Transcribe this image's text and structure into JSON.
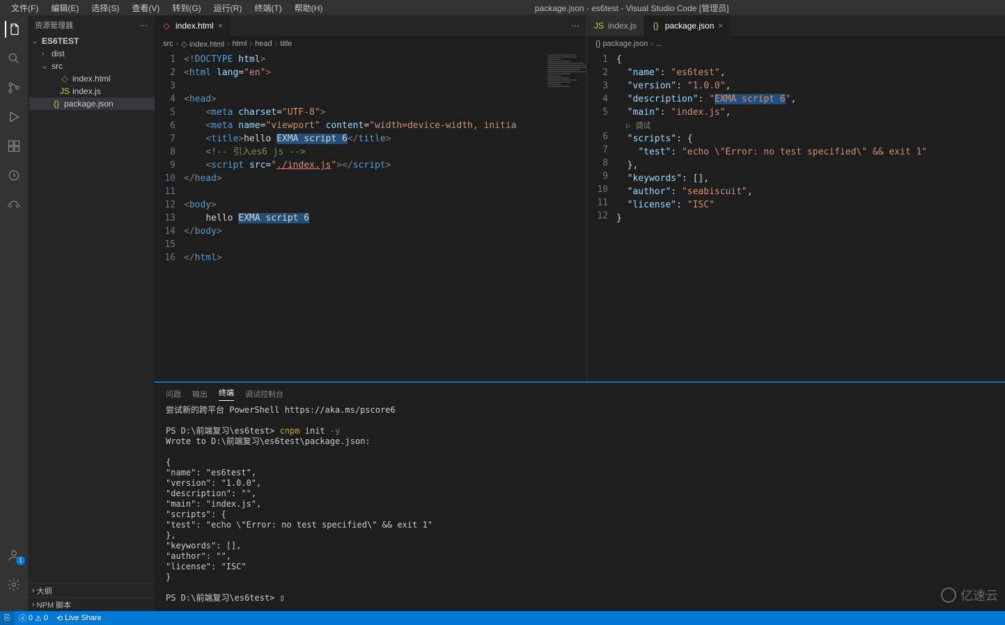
{
  "window": {
    "title": "package.json - es6test - Visual Studio Code [管理员]"
  },
  "menu": [
    "文件(F)",
    "编辑(E)",
    "选择(S)",
    "查看(V)",
    "转到(G)",
    "运行(R)",
    "终端(T)",
    "帮助(H)"
  ],
  "sidebar": {
    "title": "资源管理器",
    "root": "ES6TEST",
    "items": [
      {
        "type": "folder",
        "label": "dist",
        "depth": 1,
        "open": false
      },
      {
        "type": "folder",
        "label": "src",
        "depth": 1,
        "open": true
      },
      {
        "type": "file",
        "label": "index.html",
        "depth": 2,
        "icon": "html"
      },
      {
        "type": "file",
        "label": "index.js",
        "depth": 2,
        "icon": "js"
      },
      {
        "type": "file",
        "label": "package.json",
        "depth": 1,
        "icon": "json",
        "selected": true
      }
    ],
    "footer": [
      "大纲",
      "NPM 脚本"
    ]
  },
  "editors": {
    "left": {
      "tabs": [
        {
          "label": "index.html",
          "icon": "html",
          "active": true
        }
      ],
      "breadcrumbs": [
        "src",
        "index.html",
        "html",
        "head",
        "title"
      ],
      "lines": [
        {
          "n": 1,
          "html": "<span class='tok-bracket'>&lt;!</span><span class='tok-doctype'>DOCTYPE</span> <span class='tok-attr'>html</span><span class='tok-bracket'>&gt;</span>"
        },
        {
          "n": 2,
          "html": "<span class='tok-bracket'>&lt;</span><span class='tok-tag'>html</span> <span class='tok-attr'>lang</span>=<span class='tok-str'>\"en\"</span><span class='tok-bracket'>&gt;</span>"
        },
        {
          "n": 3,
          "html": ""
        },
        {
          "n": 4,
          "html": "<span class='tok-bracket'>&lt;</span><span class='tok-tag'>head</span><span class='tok-bracket'>&gt;</span>"
        },
        {
          "n": 5,
          "html": "    <span class='tok-bracket'>&lt;</span><span class='tok-tag'>meta</span> <span class='tok-attr'>charset</span>=<span class='tok-str'>\"UTF-8\"</span><span class='tok-bracket'>&gt;</span>"
        },
        {
          "n": 6,
          "html": "    <span class='tok-bracket'>&lt;</span><span class='tok-tag'>meta</span> <span class='tok-attr'>name</span>=<span class='tok-str'>\"viewport\"</span> <span class='tok-attr'>content</span>=<span class='tok-str'>\"width=device-width, initia</span>"
        },
        {
          "n": 7,
          "html": "    <span class='tok-bracket'>&lt;</span><span class='tok-tag'>title</span><span class='tok-bracket'>&gt;</span><span class='tok-txt'>hello </span><span class='sel-bg tok-txt'>EXMA script 6</span><span class='tok-bracket'>&lt;/</span><span class='tok-tag'>title</span><span class='tok-bracket'>&gt;</span>"
        },
        {
          "n": 8,
          "html": "    <span class='tok-comment'>&lt;!-- 引入es6 js --&gt;</span>"
        },
        {
          "n": 9,
          "html": "    <span class='tok-bracket'>&lt;</span><span class='tok-tag'>script</span> <span class='tok-attr'>src</span>=<span class='tok-str'>\"<span class='underline'>./index.js</span>\"</span><span class='tok-bracket'>&gt;&lt;/</span><span class='tok-tag'>script</span><span class='tok-bracket'>&gt;</span>"
        },
        {
          "n": 10,
          "html": "<span class='tok-bracket'>&lt;/</span><span class='tok-tag'>head</span><span class='tok-bracket'>&gt;</span>"
        },
        {
          "n": 11,
          "html": ""
        },
        {
          "n": 12,
          "html": "<span class='tok-bracket'>&lt;</span><span class='tok-tag'>body</span><span class='tok-bracket'>&gt;</span>"
        },
        {
          "n": 13,
          "html": "    <span class='tok-txt'>hello </span><span class='sel-bg tok-txt'>EXMA script 6</span>"
        },
        {
          "n": 14,
          "html": "<span class='tok-bracket'>&lt;/</span><span class='tok-tag'>body</span><span class='tok-bracket'>&gt;</span>"
        },
        {
          "n": 15,
          "html": ""
        },
        {
          "n": 16,
          "html": "<span class='tok-bracket'>&lt;/</span><span class='tok-tag'>html</span><span class='tok-bracket'>&gt;</span>"
        }
      ]
    },
    "right": {
      "tabs": [
        {
          "label": "index.js",
          "icon": "js",
          "active": false
        },
        {
          "label": "package.json",
          "icon": "json",
          "active": true
        }
      ],
      "breadcrumbs": [
        "package.json",
        "..."
      ],
      "codelens": "▷ 调试",
      "lines": [
        {
          "n": 1,
          "html": "<span class='tok-key'>{</span>"
        },
        {
          "n": 2,
          "html": "  <span class='tok-prop'>\"name\"</span>: <span class='tok-str'>\"es6test\"</span>,"
        },
        {
          "n": 3,
          "html": "  <span class='tok-prop'>\"version\"</span>: <span class='tok-str'>\"1.0.0\"</span>,"
        },
        {
          "n": 4,
          "html": "  <span class='tok-prop'>\"description\"</span>: <span class='tok-str'>\"<span class='sel-bg'>EXMA script 6</span>\"</span>,"
        },
        {
          "n": 5,
          "html": "  <span class='tok-prop'>\"main\"</span>: <span class='tok-str'>\"index.js\"</span>,"
        },
        {
          "n": 6,
          "html": "  <span class='tok-prop'>\"scripts\"</span>: {"
        },
        {
          "n": 7,
          "html": "    <span class='tok-prop'>\"test\"</span>: <span class='tok-str'>\"echo \\\"Error: no test specified\\\" &amp;&amp; exit 1\"</span>"
        },
        {
          "n": 8,
          "html": "  },"
        },
        {
          "n": 9,
          "html": "  <span class='tok-prop'>\"keywords\"</span>: [],"
        },
        {
          "n": 10,
          "html": "  <span class='tok-prop'>\"author\"</span>: <span class='tok-str'>\"seabiscuit\"</span>,"
        },
        {
          "n": 11,
          "html": "  <span class='tok-prop'>\"license\"</span>: <span class='tok-str'>\"ISC\"</span>"
        },
        {
          "n": 12,
          "html": "<span class='tok-key'>}</span>"
        }
      ]
    }
  },
  "terminal": {
    "tabs": [
      "问题",
      "输出",
      "终端",
      "调试控制台"
    ],
    "active_tab": "终端",
    "lines": [
      "尝试新的跨平台 PowerShell https://aka.ms/pscore6",
      "",
      "PS D:\\前端复习\\es6test> |CMD|cnpm|/CMD| init |FLAG|-y|/FLAG|",
      "Wrote to D:\\前端复习\\es6test\\package.json:",
      "",
      "{",
      "  \"name\": \"es6test\",",
      "  \"version\": \"1.0.0\",",
      "  \"description\": \"\",",
      "  \"main\": \"index.js\",",
      "  \"scripts\": {",
      "    \"test\": \"echo \\\"Error: no test specified\\\" && exit 1\"",
      "  },",
      "  \"keywords\": [],",
      "  \"author\": \"\",",
      "  \"license\": \"ISC\"",
      "}",
      "",
      "PS D:\\前端复习\\es6test> ▯"
    ]
  },
  "statusbar": {
    "errors": "0",
    "warnings": "0",
    "live_share": "Live Share"
  },
  "watermark": "亿速云"
}
